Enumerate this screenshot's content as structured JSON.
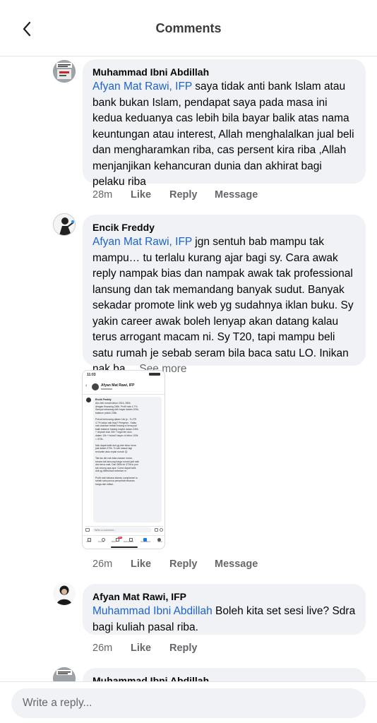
{
  "header": {
    "title": "Comments"
  },
  "comments": [
    {
      "author": "Muhammad Ibni Abdillah",
      "mention": "Afyan Mat Rawi, IFP",
      "text": " saya tidak anti bank Islam atau bank bukan Islam, pendapat saya pada masa ini kedua keduanya cas lebih bila bayar balik atas nama keuntungan atau interest,  Allah menghalalkan jual beli dan mengharamkan riba, cas persent kira riba  ,Allah menjanjikan kehancuran dunia dan akhirat bagi pelaku riba",
      "time": "28m",
      "like": "Like",
      "reply": "Reply",
      "message": "Message"
    },
    {
      "author": "Encik Freddy",
      "mention": "Afyan Mat Rawi, IFP",
      "text": " jgn sentuh bab mampu tak mampu… tu terlalu kurang ajar bagi sy. Cara awak reply nampak bias dan nampak awak tak professional lansung dan tak memandang banyak sudut. Banyak sekadar promote link web yg sudahnya iklan buku. Sy yakin career awak boleh lenyap akan datang kalau terus arrogant macam ni. Sy T20, tapi mampu beli satu rumah je sebab seram bila baca satu LO. Inikan nak ba…",
      "see_more": " See more",
      "time": "26m",
      "like": "Like",
      "reply": "Reply",
      "message": "Message"
    },
    {
      "author": "Afyan Mat Rawi, IFP",
      "mention": "Muhammad Ibni Abdillah",
      "text": " Boleh kita set sesi live? Sdra bagi kuliah pasal riba.",
      "time": "26m",
      "like": "Like",
      "reply": "Reply"
    },
    {
      "author": "Muhammad Ibni Abdillah"
    }
  ],
  "screenshot": {
    "time": "11:03",
    "page_name": "Afyan Mat Rawi, IFP",
    "commenter": "Encik Freddy",
    "lines": [
      "Aku beli rumah tahun 2016, 280k",
      "dengan financing 245k. Profit rate 4.7%.",
      "Sampai sekarang dah bayar dalam 100k,",
      "balance pokok 235k.",
      "",
      "Pokok berkurang dalam 14k je.. Tu PR",
      "4.7% kalau nak lepy? Pengean.. Kalau",
      "nak cicarkan beban hutang ni kena jual",
      "balik balance hutang maybe dalam 230k",
      "+ deposit dulu 30k + legal fee dulu",
      "dalam 10k + bulan2 bayar ch lebur 100k",
      "= 370k..",
      "",
      "Nak dapat balik duit yg dah lebur kena",
      "jual dalam 370k. Tu tak masuk lagi",
      "renovate atau repair rumah 😊",
      "",
      "Tak tau lah nak kata macam mana..",
      "secara tak lansung harga rumah jadi naik",
      "dan terus naik. Dari 280k ke 370k tu pun",
      "tak untung apa-apa. Cuma dapat balik",
      "duit yg dileburkan sebelum ni.",
      "",
      "Profit rate bahasa islamic compliance tu",
      "sebab satu punca penyebab tekanan",
      "harga dan inflasi.."
    ],
    "write_placeholder": "Write a comment...",
    "nav": [
      "Home",
      "Friends",
      "Watch",
      "Marketplace",
      "Notifications",
      "Menu"
    ],
    "badge": "99+"
  },
  "reply_bar": {
    "placeholder": "Write a reply..."
  }
}
